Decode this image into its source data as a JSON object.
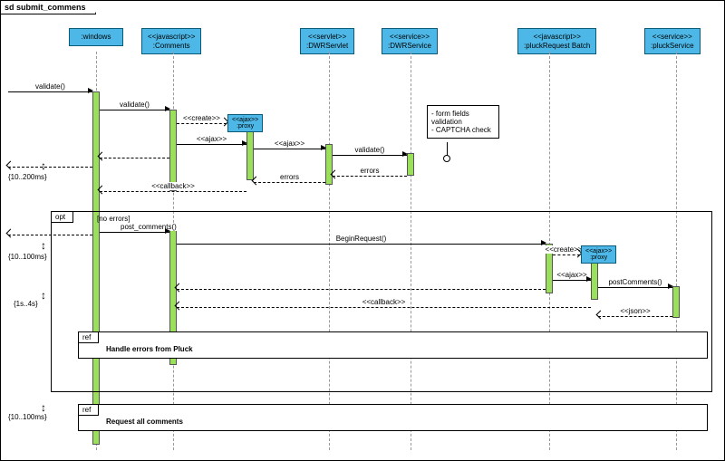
{
  "frame_title": "sd submit_commens",
  "participants": {
    "windows": {
      "label": ":windows"
    },
    "comments": {
      "stereotype": "<<javascript>>",
      "label": ":Comments"
    },
    "dwrservlet": {
      "stereotype": "<<servlet>>",
      "label": ":DWRServlet"
    },
    "dwrservice": {
      "stereotype": "<<service>>",
      "label": ":DWRService"
    },
    "pluckbatch": {
      "stereotype": "<<javascript>>",
      "label": ":pluckRequest\nBatch"
    },
    "pluckservice": {
      "stereotype": "<<service>>",
      "label": ":pluckService"
    }
  },
  "proxies": {
    "proxy1": {
      "stereotype": "<<ajax>>",
      "label": ":proxy"
    },
    "proxy2": {
      "stereotype": "<<ajax>>",
      "label": ":proxy"
    }
  },
  "messages": {
    "m1": "validate()",
    "m2": "validate()",
    "m3": "<<create>>",
    "m4": "<<ajax>>",
    "m5": "<<ajax>>",
    "m6": "validate()",
    "m7": "errors",
    "m8": "errors",
    "m9": "<<callback>>",
    "m10": "post_comments()",
    "m11": "BeginRequest()",
    "m12": "<<create>>",
    "m13": "<<ajax>>",
    "m14": "postComments()",
    "m15": "<<json>>",
    "m16": "<<callback>>"
  },
  "fragments": {
    "opt": {
      "label": "opt",
      "guard": "[no errors]"
    },
    "ref1": {
      "label": "ref",
      "text": "Handle errors from Pluck"
    },
    "ref2": {
      "label": "ref",
      "text": "Request all comments"
    }
  },
  "note": {
    "line1": "- form fields",
    "line2": "validation",
    "line3": "- CAPTCHA check"
  },
  "timings": {
    "t1": "{10..200ms}",
    "t2": "{10..100ms}",
    "t3": "{1s..4s}",
    "t4": "{10..100ms}"
  }
}
